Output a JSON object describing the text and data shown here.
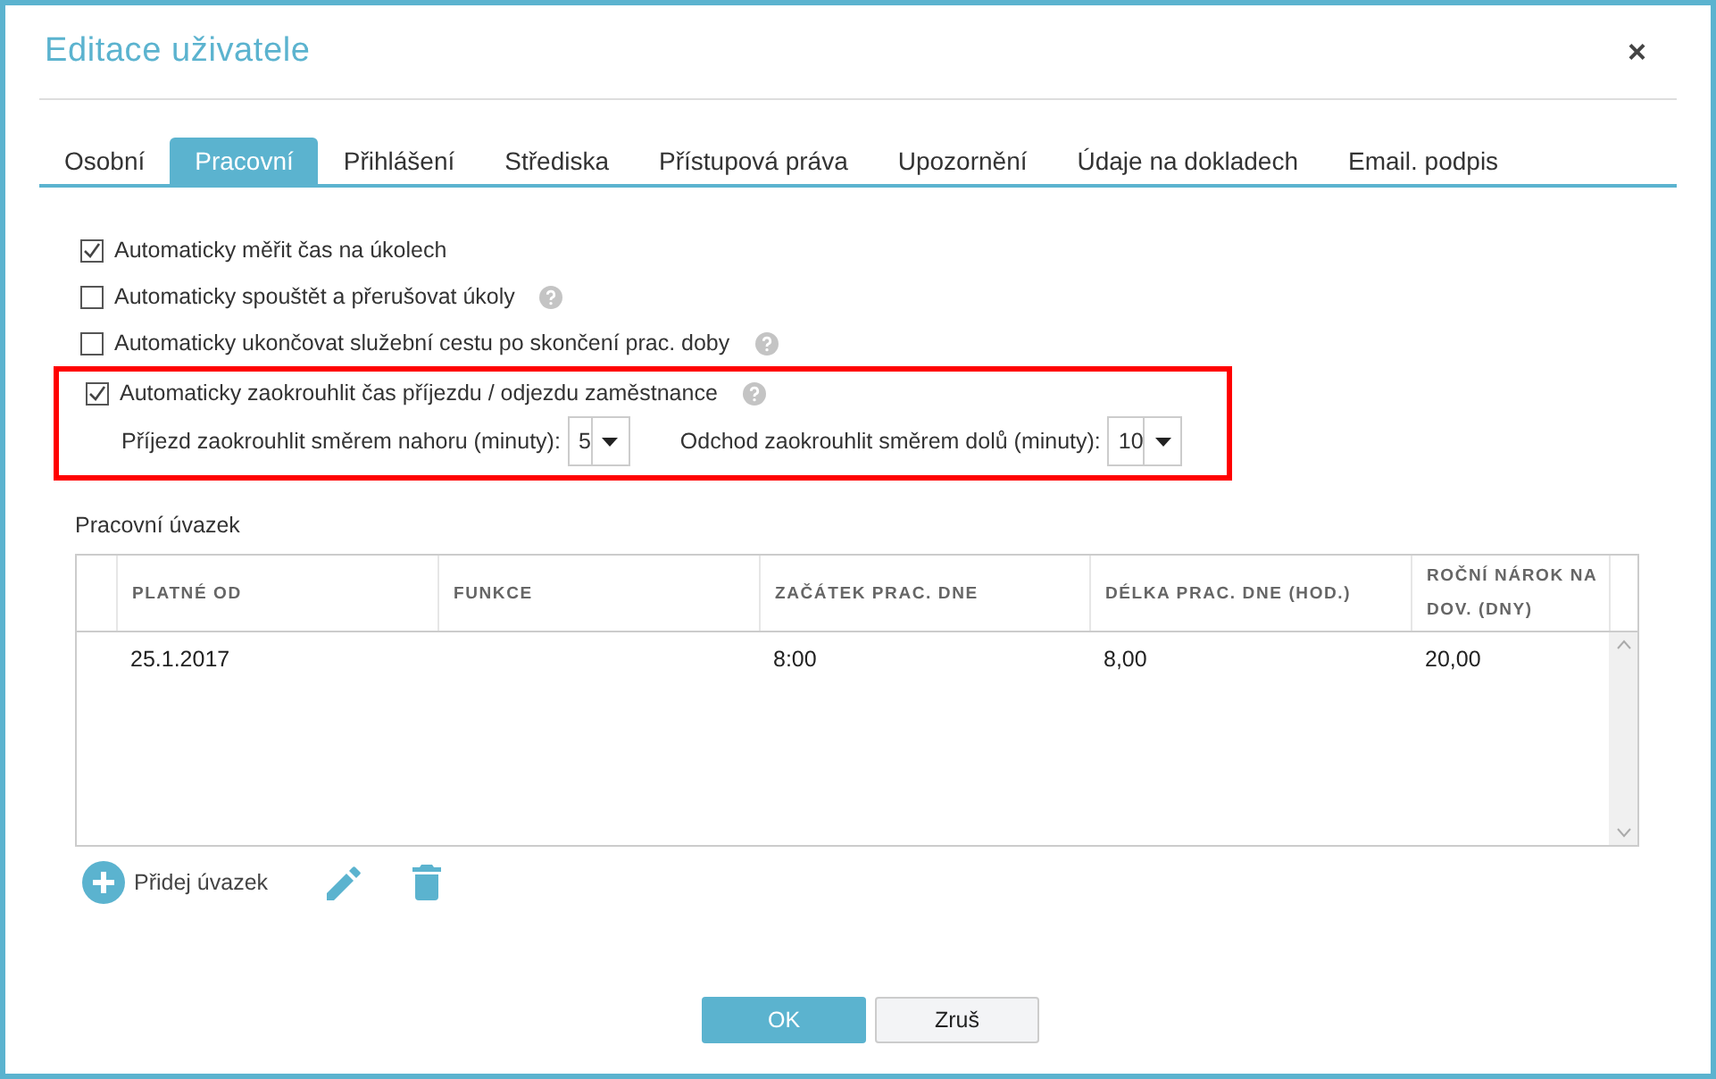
{
  "window": {
    "title": "Editace uživatele",
    "close": "×"
  },
  "tabs": [
    {
      "label": "Osobní",
      "selected": false
    },
    {
      "label": "Pracovní",
      "selected": true
    },
    {
      "label": "Přihlášení",
      "selected": false
    },
    {
      "label": "Střediska",
      "selected": false
    },
    {
      "label": "Přístupová práva",
      "selected": false
    },
    {
      "label": "Upozornění",
      "selected": false
    },
    {
      "label": "Údaje na dokladech",
      "selected": false
    },
    {
      "label": "Email. podpis",
      "selected": false
    }
  ],
  "options": [
    {
      "label": "Automaticky měřit čas na úkolech",
      "checked": true,
      "help": false
    },
    {
      "label": "Automaticky spouštět a přerušovat úkoly",
      "checked": false,
      "help": true
    },
    {
      "label": "Automaticky ukončovat služební cestu po skončení prac. doby",
      "checked": false,
      "help": true
    },
    {
      "label": "Automaticky zaokrouhlit čas příjezdu / odjezdu zaměstnance",
      "checked": true,
      "help": true,
      "highlighted": true,
      "selects": [
        {
          "label": "Příjezd zaokrouhlit směrem nahoru (minuty):",
          "value": "5"
        },
        {
          "label": "Odchod zaokrouhlit směrem dolů (minuty):",
          "value": "10"
        }
      ]
    }
  ],
  "section_title": "Pracovní úvazek",
  "table": {
    "columns": [
      {
        "label": "PLATNÉ OD"
      },
      {
        "label": "FUNKCE"
      },
      {
        "label": "ZAČÁTEK PRAC. DNE"
      },
      {
        "label": "DÉLKA PRAC. DNE (HOD.)"
      },
      {
        "label": "ROČNÍ NÁROK NA DOV. (DNY)"
      }
    ],
    "rows": [
      [
        "25.1.2017",
        "",
        "8:00",
        "8,00",
        "20,00"
      ]
    ]
  },
  "actions": {
    "add": "Přidej úvazek"
  },
  "buttons": [
    {
      "label": "OK",
      "kind": "primary"
    },
    {
      "label": "Zruš",
      "kind": "secondary"
    }
  ]
}
